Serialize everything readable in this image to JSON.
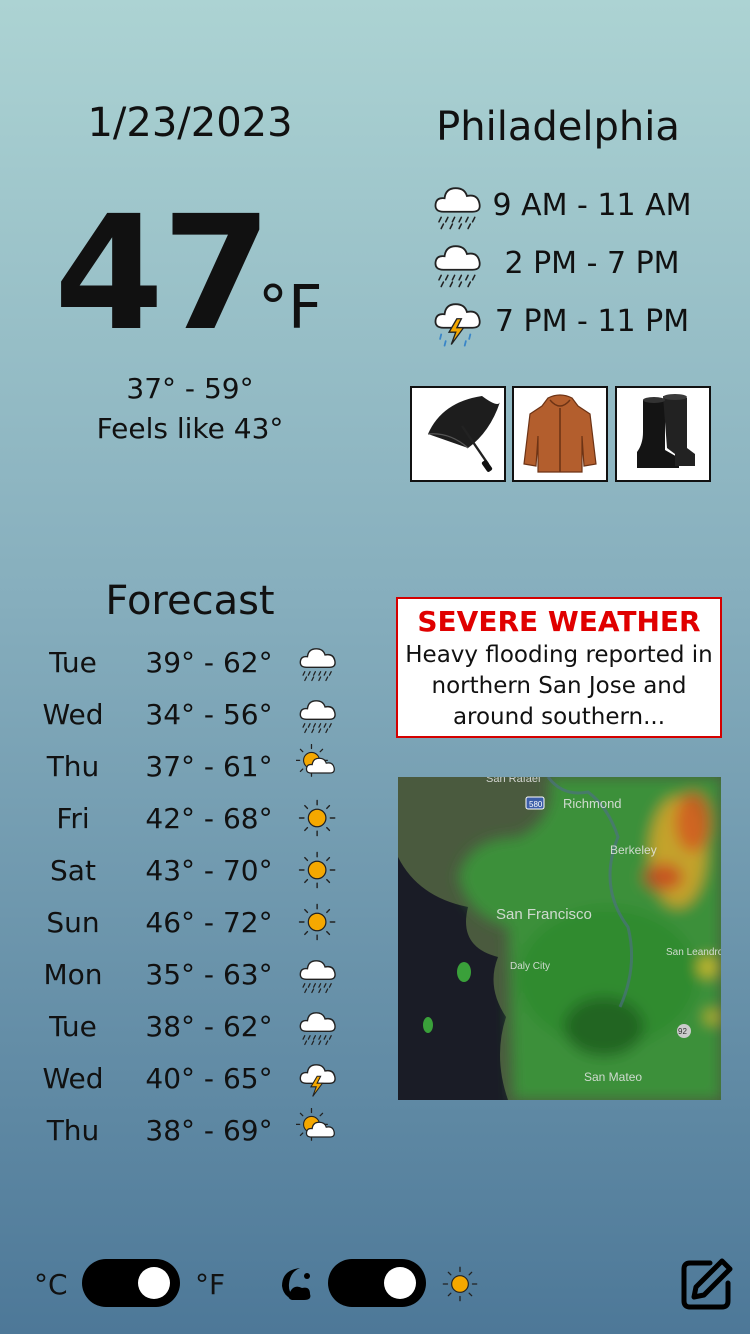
{
  "current": {
    "date": "1/23/2023",
    "temperature": "47",
    "unit": "°F",
    "range": "37° - 59°",
    "feels_like": "Feels like 43°",
    "city": "Philadelphia"
  },
  "periods": [
    {
      "time": "9 AM - 11 AM",
      "icon": "rain-cloud-icon"
    },
    {
      "time": "2 PM - 7 PM",
      "icon": "rain-cloud-icon"
    },
    {
      "time": "7 PM - 11 PM",
      "icon": "thunderstorm-icon"
    }
  ],
  "recommendations": [
    "umbrella",
    "rain-jacket",
    "rain-boots"
  ],
  "forecast": {
    "title": "Forecast",
    "days": [
      {
        "day": "Tue",
        "range": "39° - 62°",
        "icon": "rain"
      },
      {
        "day": "Wed",
        "range": "34° - 56°",
        "icon": "rain"
      },
      {
        "day": "Thu",
        "range": "37° - 61°",
        "icon": "partly-cloudy"
      },
      {
        "day": "Fri",
        "range": "42° - 68°",
        "icon": "sun"
      },
      {
        "day": "Sat",
        "range": "43° - 70°",
        "icon": "sun"
      },
      {
        "day": "Sun",
        "range": "46° - 72°",
        "icon": "sun"
      },
      {
        "day": "Mon",
        "range": "35° - 63°",
        "icon": "rain"
      },
      {
        "day": "Tue",
        "range": "38° - 62°",
        "icon": "rain"
      },
      {
        "day": "Wed",
        "range": "40° - 65°",
        "icon": "thunderstorm"
      },
      {
        "day": "Thu",
        "range": "38° - 69°",
        "icon": "partly-cloudy"
      }
    ]
  },
  "alert": {
    "title": "SEVERE WEATHER",
    "body": "Heavy flooding reported in northern San Jose and around southern..."
  },
  "map": {
    "labels": [
      "San Rafael",
      "Richmond",
      "Berkeley",
      "San Francisco",
      "Daly City",
      "San Leandro",
      "San Mateo",
      "580",
      "92"
    ]
  },
  "controls": {
    "celsius_label": "°C",
    "fahrenheit_label": "°F",
    "unit_toggle_state": "fahrenheit",
    "theme_toggle_state": "day"
  },
  "colors": {
    "alert_red": "#e00000",
    "sun": "#f5a800"
  }
}
